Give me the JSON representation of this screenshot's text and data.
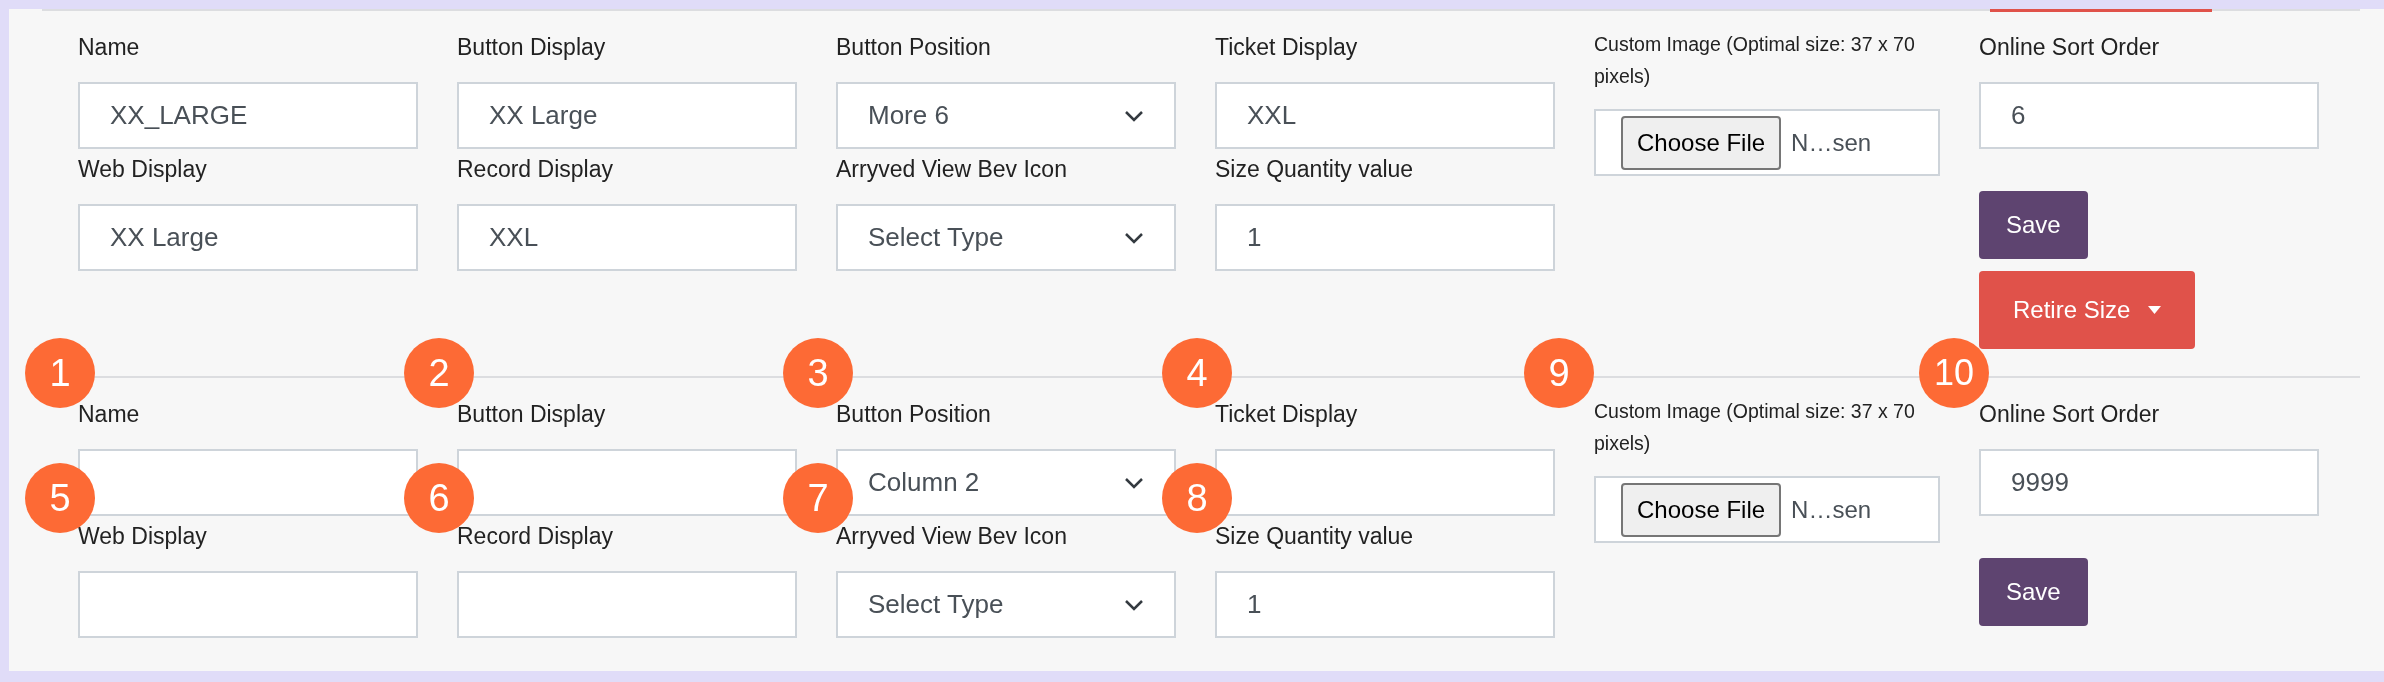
{
  "sections": [
    {
      "fields": [
        {
          "kind": "text",
          "label": "Name",
          "value": "XX_LARGE"
        },
        {
          "kind": "text",
          "label": "Button Display",
          "value": "XX Large"
        },
        {
          "kind": "select",
          "label": "Button Position",
          "value": "More 6"
        },
        {
          "kind": "text",
          "label": "Ticket Display",
          "value": "XXL"
        },
        {
          "kind": "text",
          "label": "Web Display",
          "value": "XX Large"
        },
        {
          "kind": "text",
          "label": "Record Display",
          "value": "XXL"
        },
        {
          "kind": "select",
          "label": "Arryved View Bev Icon",
          "value": "Select Type"
        },
        {
          "kind": "text",
          "label": "Size Quantity value",
          "value": "1"
        }
      ],
      "custom_image": {
        "label": "Custom Image (Optimal size: 37 x 70 pixels)",
        "button": "Choose File",
        "status": "N…sen"
      },
      "sort_order": {
        "label": "Online Sort Order",
        "value": "6"
      },
      "save": "Save",
      "retire": "Retire Size"
    },
    {
      "fields": [
        {
          "kind": "text",
          "label": "Name",
          "badge": "1"
        },
        {
          "kind": "text",
          "label": "Button Display",
          "badge": "2"
        },
        {
          "kind": "select",
          "label": "Button Position",
          "value": "Column 2",
          "badge": "3"
        },
        {
          "kind": "text",
          "label": "Ticket Display",
          "badge": "4"
        },
        {
          "kind": "text",
          "label": "Web Display",
          "badge": "5"
        },
        {
          "kind": "text",
          "label": "Record Display",
          "badge": "6"
        },
        {
          "kind": "select",
          "label": "Arryved View Bev Icon",
          "value": "Select Type",
          "badge": "7"
        },
        {
          "kind": "text",
          "label": "Size Quantity value",
          "value": "1",
          "badge": "8"
        }
      ],
      "custom_image": {
        "label": "Custom Image (Optimal size: 37 x 70 pixels)",
        "button": "Choose File",
        "status": "N…sen",
        "badge": "9"
      },
      "sort_order": {
        "label": "Online Sort Order",
        "value": "9999",
        "badge": "10"
      },
      "save": "Save"
    }
  ]
}
